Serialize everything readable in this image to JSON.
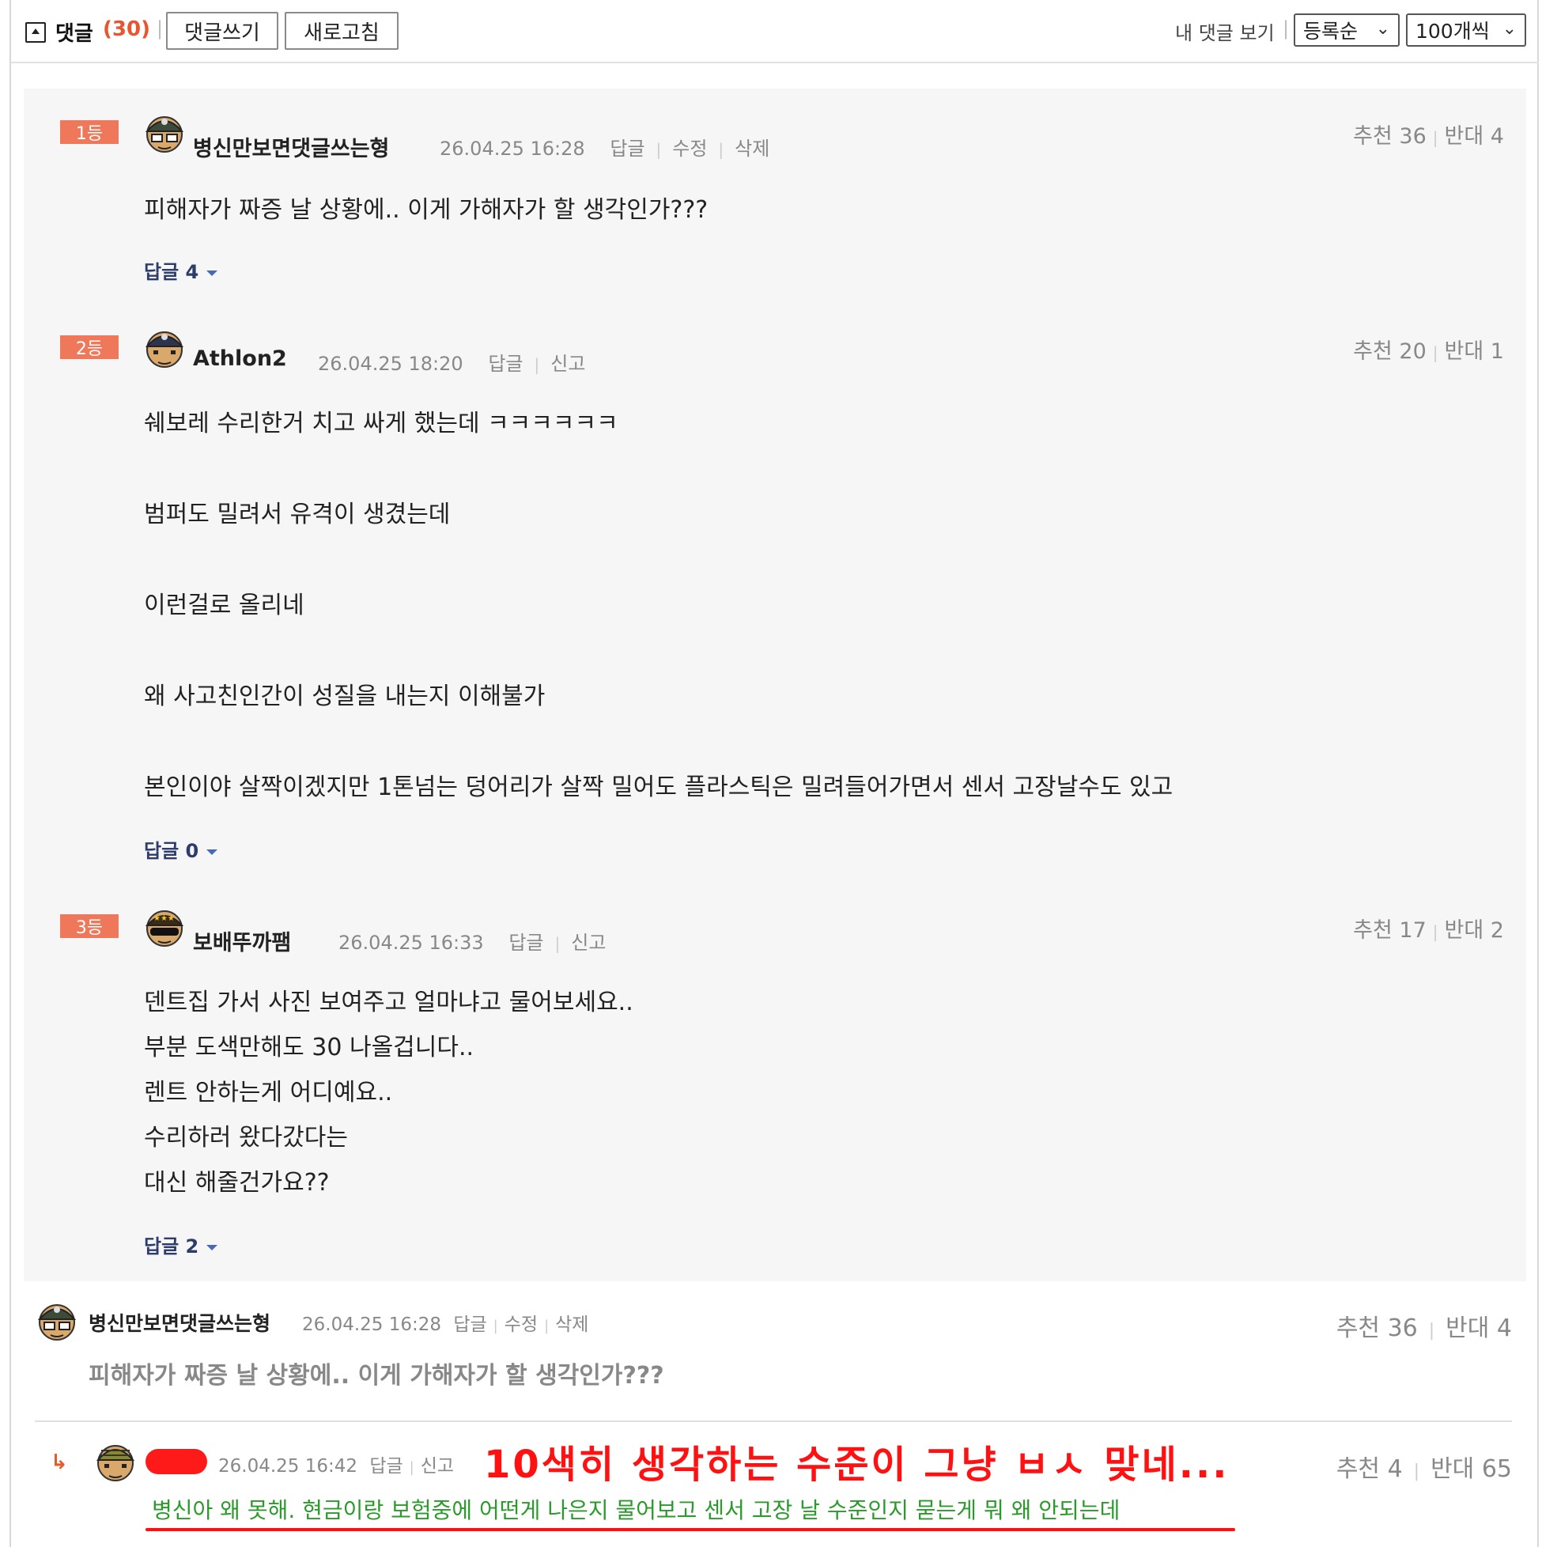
{
  "header": {
    "title": "댓글",
    "count": "(30)",
    "write_button": "댓글쓰기",
    "refresh_button": "새로고침",
    "my_comments_link": "내 댓글 보기",
    "sort_select": "등록순",
    "page_size_select": "100개씩"
  },
  "best": [
    {
      "rank": "1등",
      "nick": "병신만보면댓글쓰는형",
      "date": "26.04.25 16:28",
      "actions": [
        "답글",
        "수정",
        "삭제"
      ],
      "up": "추천 36",
      "down": "반대 4",
      "lines": [
        "피해자가 짜증 날 상황에.. 이게 가해자가 할 생각인가???"
      ],
      "replies": "답글 4"
    },
    {
      "rank": "2등",
      "nick": "Athlon2",
      "date": "26.04.25 18:20",
      "actions": [
        "답글",
        "신고"
      ],
      "up": "추천 20",
      "down": "반대 1",
      "lines": [
        "쉐보레 수리한거 치고 싸게 했는데 ㅋㅋㅋㅋㅋㅋ",
        "범퍼도 밀려서 유격이 생겼는데",
        "이런걸로 올리네",
        "왜 사고친인간이 성질을 내는지 이해불가",
        "본인이야 살짝이겠지만 1톤넘는 덩어리가 살짝 밀어도 플라스틱은 밀려들어가면서 센서 고장날수도 있고"
      ],
      "replies": "답글 0"
    },
    {
      "rank": "3등",
      "nick": "보배뚜까팸",
      "date": "26.04.25 16:33",
      "actions": [
        "답글",
        "신고"
      ],
      "up": "추천 17",
      "down": "반대 2",
      "lines": [
        "덴트집 가서 사진 보여주고 얼마냐고 물어보세요..",
        "부분 도색만해도 30 나올겁니다..",
        "렌트 안하는게 어디예요..",
        "수리하러 왔다갔다는",
        "대신 해줄건가요??"
      ],
      "replies": "답글 2"
    }
  ],
  "comments": [
    {
      "nick": "병신만보면댓글쓰는형",
      "date": "26.04.25 16:28",
      "actions": [
        "답글",
        "수정",
        "삭제"
      ],
      "up": "추천 36",
      "down": "반대 4",
      "body": "피해자가 짜증 날 상황에.. 이게 가해자가 할 생각인가???"
    },
    {
      "arrow": "↳",
      "date": "26.04.25 16:42",
      "actions": [
        "답글",
        "신고"
      ],
      "up": "추천 4",
      "down": "반대 65",
      "annotation": "10색히 생각하는 수준이 그냥 ㅂㅅ 맞네...",
      "body": "병신아 왜 못해. 현금이랑 보험중에 어떤게 나은지 물어보고 센서 고장 날 수준인지 묻는게 뭐 왜 안되는데"
    }
  ],
  "colors": {
    "accent": "#e8552f",
    "badge": "#f0785a",
    "reply_link": "#2d3d6b",
    "annotation_red": "#ff1111",
    "reply_green": "#2a9a2a"
  }
}
